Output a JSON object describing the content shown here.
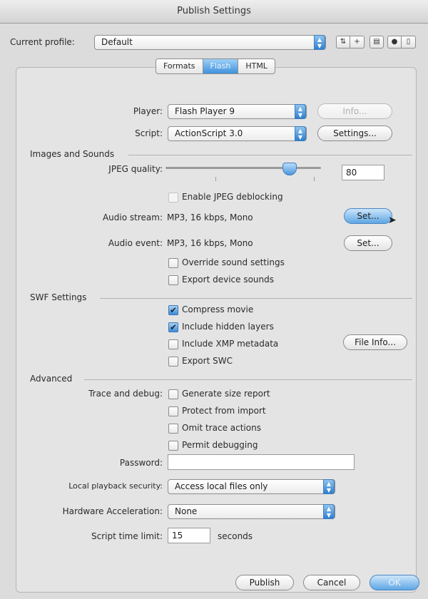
{
  "window": {
    "title": "Publish Settings"
  },
  "profile": {
    "label": "Current profile:",
    "value": "Default"
  },
  "tabs": [
    "Formats",
    "Flash",
    "HTML"
  ],
  "flash": {
    "player": {
      "label": "Player:",
      "value": "Flash Player 9",
      "info_button": "Info..."
    },
    "script": {
      "label": "Script:",
      "value": "ActionScript 3.0",
      "settings_button": "Settings..."
    }
  },
  "images_sounds": {
    "heading": "Images and Sounds",
    "jpeg_quality": {
      "label": "JPEG quality:",
      "value": "80",
      "slider_fraction": 0.8
    },
    "jpeg_deblocking": {
      "label": "Enable JPEG deblocking",
      "checked": false,
      "enabled": false
    },
    "audio_stream": {
      "label": "Audio stream:",
      "value": "MP3, 16 kbps, Mono",
      "button": "Set..."
    },
    "audio_event": {
      "label": "Audio event:",
      "value": "MP3, 16 kbps, Mono",
      "button": "Set..."
    },
    "override_sound": {
      "label": "Override sound settings",
      "checked": false
    },
    "export_device_sounds": {
      "label": "Export device sounds",
      "checked": false
    }
  },
  "swf_settings": {
    "heading": "SWF Settings",
    "compress_movie": {
      "label": "Compress movie",
      "checked": true
    },
    "include_hidden_layers": {
      "label": "Include hidden layers",
      "checked": true
    },
    "include_xmp": {
      "label": "Include XMP metadata",
      "checked": false
    },
    "export_swc": {
      "label": "Export SWC",
      "checked": false
    },
    "file_info_button": "File Info..."
  },
  "advanced": {
    "heading": "Advanced",
    "trace_debug_label": "Trace and debug:",
    "generate_size_report": {
      "label": "Generate size report",
      "checked": false
    },
    "protect_from_import": {
      "label": "Protect from import",
      "checked": false
    },
    "omit_trace_actions": {
      "label": "Omit trace actions",
      "checked": false
    },
    "permit_debugging": {
      "label": "Permit debugging",
      "checked": false
    },
    "password": {
      "label": "Password:",
      "value": ""
    },
    "local_playback_security": {
      "label": "Local playback security:",
      "value": "Access local files only"
    },
    "hardware_acceleration": {
      "label": "Hardware Acceleration:",
      "value": "None"
    },
    "script_time_limit": {
      "label": "Script time limit:",
      "value": "15",
      "unit": "seconds"
    }
  },
  "footer": {
    "publish": "Publish",
    "cancel": "Cancel",
    "ok": "OK"
  },
  "colors": {
    "accent": "#3f91de",
    "window_bg": "#dcdcdc"
  }
}
